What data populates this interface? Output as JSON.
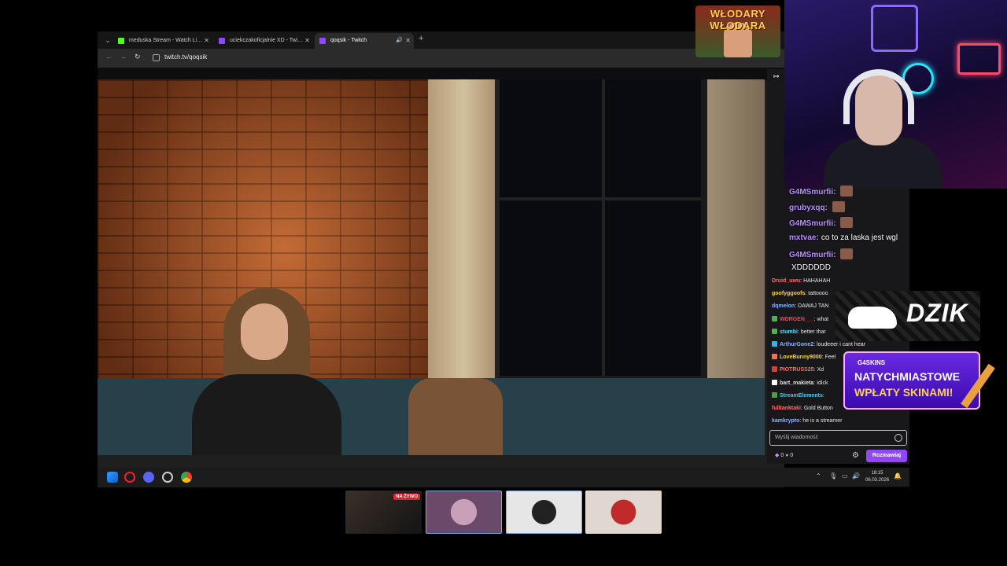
{
  "browser": {
    "tabs": [
      {
        "title": "meduska Stream - Watch Live o",
        "favicon_color": "#53fc18",
        "active": false
      },
      {
        "title": "uciekczakoficjalnie XD - Twitch",
        "favicon_color": "#9147ff",
        "active": false
      },
      {
        "title": "qoqsik - Twitch",
        "favicon_color": "#9147ff",
        "active": true
      }
    ],
    "url": "twitch.tv/qoqsik"
  },
  "chat": {
    "messages": [
      {
        "user": "Druid_uwu",
        "text": "HAHAHAH",
        "color": "#ff6b6b",
        "badge": ""
      },
      {
        "user": "goofyggoofs",
        "text": "tattoooo",
        "color": "#f5d442",
        "badge": ""
      },
      {
        "user": "dqmelon",
        "text": "DAWAJ TAN",
        "color": "#8ab4ff",
        "badge": ""
      },
      {
        "user": "WDRGEN___",
        "text": "what",
        "color": "#ff3b3b",
        "badge": "#4caf50"
      },
      {
        "user": "stumbi",
        "text": "better thar",
        "color": "#66d9ef",
        "badge": "#4caf50"
      },
      {
        "user": "ArthurGone2",
        "text": "loudeeer i cant hear",
        "color": "#8ab4ff",
        "badge": "#29b6f6"
      },
      {
        "user": "LoveBunny9000",
        "text": "Feel",
        "color": "#f5d442",
        "badge": "#ff7043"
      },
      {
        "user": "PIOTRUSS25",
        "text": "Xd",
        "color": "#ff6b6b",
        "badge": "#e53935"
      },
      {
        "user": "bart_makieta",
        "text": "Idick",
        "color": "#e0e0e0",
        "badge": "#fafafa"
      },
      {
        "user": "StreamElements",
        "text": "",
        "color": "#5bc0eb",
        "badge": "#43a047"
      },
      {
        "user": "fulltanktaki",
        "text": "Gold Button",
        "color": "#ff6b6b",
        "badge": ""
      },
      {
        "user": "kamkrypto",
        "text": "he is a streamer",
        "color": "#8ab4ff",
        "badge": ""
      }
    ],
    "input_placeholder": "Wyślij wiadomość",
    "points_a": "0",
    "points_b": "0",
    "chat_button": "Rozmawiaj"
  },
  "overlay_chat": [
    {
      "user": "G4MSmurfii:",
      "text": ""
    },
    {
      "user": "grubyxqq:",
      "text": ""
    },
    {
      "user": "G4MSmurfii:",
      "text": ""
    },
    {
      "user": "mxtvae:",
      "text": "co to za laska jest wgl"
    },
    {
      "user": "G4MSmurfii:",
      "text": ""
    },
    {
      "user": "",
      "text": "XDDDDDD"
    }
  ],
  "logo": {
    "text": "WŁODARY WŁODARA"
  },
  "sponsor": {
    "name": "DZIK"
  },
  "promo": {
    "brand": "G4SKINS",
    "line1": "NATYCHMIASTOWE",
    "line2": "WPŁATY SKINAMI!"
  },
  "taskbar": {
    "time": "18:15",
    "date": "06.03.2026"
  },
  "thumbnails": {
    "live_badge": "NA ŻYWO"
  },
  "colors": {
    "twitch_purple": "#9147ff",
    "chat_bg": "#18181b"
  }
}
